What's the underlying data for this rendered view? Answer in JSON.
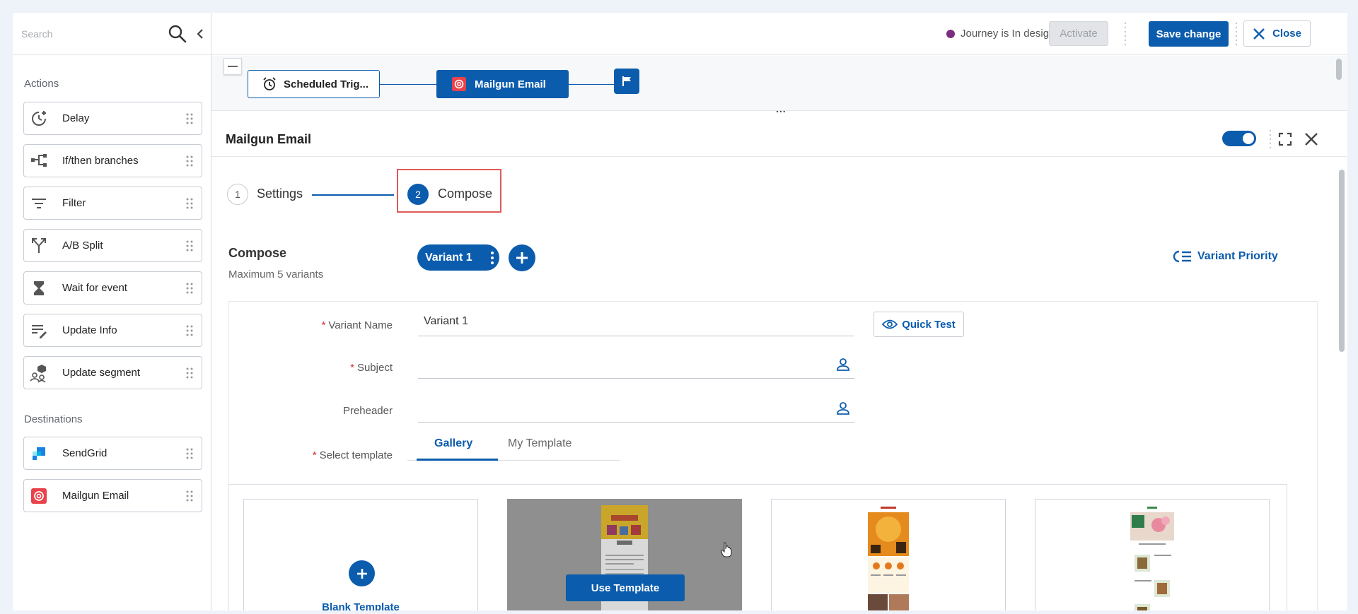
{
  "sidebar": {
    "search_placeholder": "Search",
    "actions_title": "Actions",
    "actions": [
      {
        "label": "Delay",
        "icon": "delay-clock-icon"
      },
      {
        "label": "If/then branches",
        "icon": "branches-icon"
      },
      {
        "label": "Filter",
        "icon": "filter-icon"
      },
      {
        "label": "A/B Split",
        "icon": "split-icon"
      },
      {
        "label": "Wait for event",
        "icon": "hourglass-icon"
      },
      {
        "label": "Update Info",
        "icon": "edit-list-icon"
      },
      {
        "label": "Update segment",
        "icon": "segment-icon"
      }
    ],
    "destinations_title": "Destinations",
    "destinations": [
      {
        "label": "SendGrid",
        "icon": "sendgrid-icon"
      },
      {
        "label": "Mailgun Email",
        "icon": "mailgun-icon"
      }
    ]
  },
  "topbar": {
    "status_text": "Journey is In design",
    "status_color": "#7b2d7f",
    "activate_label": "Activate",
    "save_label": "Save change",
    "close_label": "Close"
  },
  "flow": {
    "trigger_label": "Scheduled Trig...",
    "email_label": "Mailgun Email",
    "ellipsis": "..."
  },
  "panel": {
    "title": "Mailgun Email",
    "steps": [
      {
        "number": "1",
        "label": "Settings"
      },
      {
        "number": "2",
        "label": "Compose"
      }
    ],
    "compose_title": "Compose",
    "compose_subtitle": "Maximum 5 variants",
    "variant_pill": "Variant 1",
    "variant_priority": "Variant Priority",
    "quick_test": "Quick Test",
    "fields": {
      "variant_name_label": "Variant Name",
      "variant_name_value": "Variant 1",
      "subject_label": "Subject",
      "subject_value": "",
      "preheader_label": "Preheader",
      "preheader_value": "",
      "select_template_label": "Select template",
      "required_mark": "*"
    },
    "tabs": [
      "Gallery",
      "My Template"
    ],
    "gallery": {
      "blank_label": "Blank Template",
      "use_template_label": "Use Template"
    }
  },
  "colors": {
    "primary": "#0b5cad",
    "highlight": "#e05a5a"
  }
}
